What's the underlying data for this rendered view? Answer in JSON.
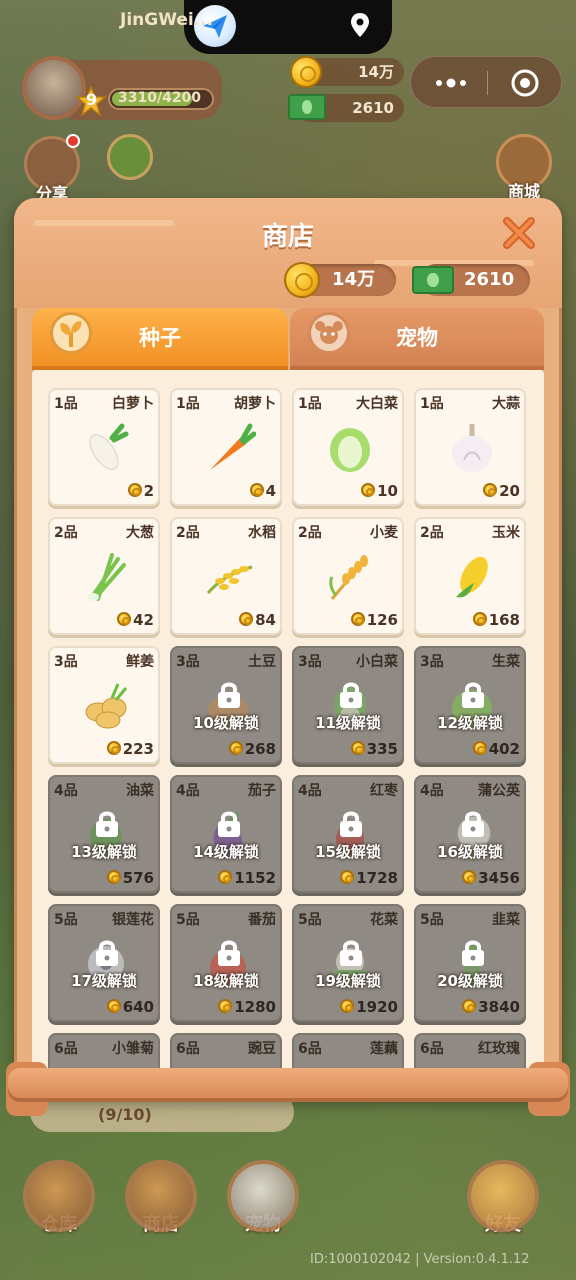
{
  "status": {
    "app_icon": "paper-plane-icon",
    "location_icon": "location-pin-icon"
  },
  "player": {
    "name": "JinGWei...",
    "level": "9",
    "xp": "3310/4200",
    "xp_fraction": 0.788
  },
  "hud": {
    "coins": "14万",
    "cash": "2610"
  },
  "side": {
    "share_label": "分享",
    "mall_label": "商城"
  },
  "shop": {
    "title": "商店",
    "coins": "14万",
    "cash": "2610",
    "tabs": [
      {
        "label": "种子",
        "active": true
      },
      {
        "label": "宠物",
        "active": false
      }
    ],
    "items": [
      {
        "grade": "1品",
        "name": "白萝卜",
        "price": "2",
        "locked": false,
        "crop": "daikon"
      },
      {
        "grade": "1品",
        "name": "胡萝卜",
        "price": "4",
        "locked": false,
        "crop": "carrot"
      },
      {
        "grade": "1品",
        "name": "大白菜",
        "price": "10",
        "locked": false,
        "crop": "cabbage"
      },
      {
        "grade": "1品",
        "name": "大蒜",
        "price": "20",
        "locked": false,
        "crop": "garlic"
      },
      {
        "grade": "2品",
        "name": "大葱",
        "price": "42",
        "locked": false,
        "crop": "scallion"
      },
      {
        "grade": "2品",
        "name": "水稻",
        "price": "84",
        "locked": false,
        "crop": "rice"
      },
      {
        "grade": "2品",
        "name": "小麦",
        "price": "126",
        "locked": false,
        "crop": "wheat"
      },
      {
        "grade": "2品",
        "name": "玉米",
        "price": "168",
        "locked": false,
        "crop": "corn"
      },
      {
        "grade": "3品",
        "name": "鲜姜",
        "price": "223",
        "locked": false,
        "crop": "ginger"
      },
      {
        "grade": "3品",
        "name": "土豆",
        "price": "268",
        "locked": true,
        "unlock": "10级解锁",
        "crop": "potato"
      },
      {
        "grade": "3品",
        "name": "小白菜",
        "price": "335",
        "locked": true,
        "unlock": "11级解锁",
        "crop": "bokchoy"
      },
      {
        "grade": "3品",
        "name": "生菜",
        "price": "402",
        "locked": true,
        "unlock": "12级解锁",
        "crop": "lettuce"
      },
      {
        "grade": "4品",
        "name": "油菜",
        "price": "576",
        "locked": true,
        "unlock": "13级解锁",
        "crop": "rape"
      },
      {
        "grade": "4品",
        "name": "茄子",
        "price": "1152",
        "locked": true,
        "unlock": "14级解锁",
        "crop": "eggplant"
      },
      {
        "grade": "4品",
        "name": "红枣",
        "price": "1728",
        "locked": true,
        "unlock": "15级解锁",
        "crop": "jujube"
      },
      {
        "grade": "4品",
        "name": "蒲公英",
        "price": "3456",
        "locked": true,
        "unlock": "16级解锁",
        "crop": "dandelion"
      },
      {
        "grade": "5品",
        "name": "银莲花",
        "price": "640",
        "locked": true,
        "unlock": "17级解锁",
        "crop": "anemone"
      },
      {
        "grade": "5品",
        "name": "番茄",
        "price": "1280",
        "locked": true,
        "unlock": "18级解锁",
        "crop": "tomato"
      },
      {
        "grade": "5品",
        "name": "花菜",
        "price": "1920",
        "locked": true,
        "unlock": "19级解锁",
        "crop": "cauliflower"
      },
      {
        "grade": "5品",
        "name": "韭菜",
        "price": "3840",
        "locked": true,
        "unlock": "20级解锁",
        "crop": "chives"
      },
      {
        "grade": "6品",
        "name": "小雏菊",
        "price": "",
        "locked": true,
        "unlock": "",
        "crop": "daisy"
      },
      {
        "grade": "6品",
        "name": "豌豆",
        "price": "",
        "locked": true,
        "unlock": "",
        "crop": "pea"
      },
      {
        "grade": "6品",
        "name": "莲藕",
        "price": "",
        "locked": true,
        "unlock": "",
        "crop": "lotus-root"
      },
      {
        "grade": "6品",
        "name": "红玫瑰",
        "price": "",
        "locked": true,
        "unlock": "",
        "crop": "rose"
      }
    ]
  },
  "task": {
    "progress": "(9/10)"
  },
  "bottom": {
    "warehouse": "仓库",
    "shop": "商店",
    "pet": "宠物",
    "friends": "好友"
  },
  "footer": {
    "version": "ID:1000102042 | Version:0.4.1.12"
  },
  "colors": {
    "panel": "#e9b07f",
    "tab_active": "#f08f22",
    "locked_card": "#8f8a83",
    "coin": "#f3b51c",
    "cash": "#3fa049"
  }
}
